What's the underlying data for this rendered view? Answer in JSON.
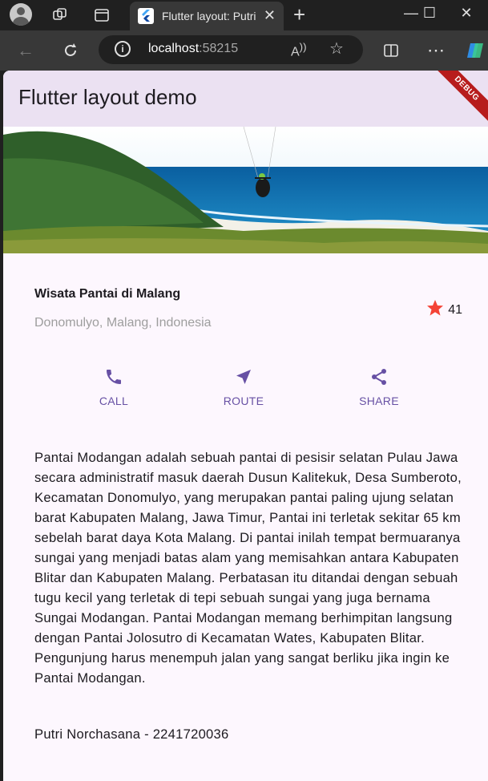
{
  "browser": {
    "tab_title": "Flutter layout: Putri",
    "url_host": "localhost",
    "url_port": ":58215"
  },
  "app": {
    "appbar_title": "Flutter layout demo",
    "debug_banner": "DEBUG",
    "place_name": "Wisata Pantai di Malang",
    "place_location": "Donomulyo, Malang, Indonesia",
    "rating_count": "41",
    "star_color": "#f44336",
    "accent_color": "#6750a4",
    "actions": [
      {
        "label": "CALL",
        "icon": "phone-icon"
      },
      {
        "label": "ROUTE",
        "icon": "navigation-icon"
      },
      {
        "label": "SHARE",
        "icon": "share-icon"
      }
    ],
    "description": "Pantai Modangan adalah sebuah pantai di pesisir selatan Pulau Jawa secara administratif masuk daerah Dusun Kalitekuk, Desa Sumberoto, Kecamatan Donomulyo, yang merupakan pantai paling ujung selatan barat Kabupaten Malang, Jawa Timur, Pantai ini terletak sekitar 65 km sebelah barat daya Kota Malang. Di pantai inilah tempat bermuaranya sungai yang menjadi batas alam yang memisahkan antara Kabupaten Blitar dan Kabupaten Malang. Perbatasan itu ditandai dengan sebuah tugu kecil yang terletak di tepi sebuah sungai yang juga bernama Sungai Modangan. Pantai Modangan memang berhimpitan langsung dengan Pantai Jolosutro di Kecamatan Wates, Kabupaten Blitar. Pengunjung harus menempuh jalan yang sangat berliku jika ingin ke Pantai Modangan.",
    "author": "Putri Norchasana - 2241720036"
  }
}
